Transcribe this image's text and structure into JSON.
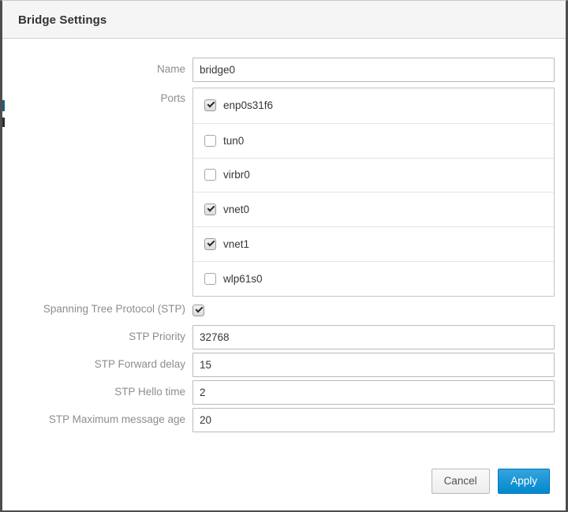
{
  "dialog": {
    "title": "Bridge Settings"
  },
  "form": {
    "name": {
      "label": "Name",
      "value": "bridge0",
      "placeholder": ""
    },
    "ports": {
      "label": "Ports",
      "items": [
        {
          "name": "enp0s31f6",
          "checked": true
        },
        {
          "name": "tun0",
          "checked": false
        },
        {
          "name": "virbr0",
          "checked": false
        },
        {
          "name": "vnet0",
          "checked": true
        },
        {
          "name": "vnet1",
          "checked": true
        },
        {
          "name": "wlp61s0",
          "checked": false
        }
      ]
    },
    "stp": {
      "label": "Spanning Tree Protocol (STP)",
      "checked": true
    },
    "stp_priority": {
      "label": "STP Priority",
      "value": "32768",
      "placeholder": ""
    },
    "stp_forward_delay": {
      "label": "STP Forward delay",
      "value": "15",
      "placeholder": ""
    },
    "stp_hello_time": {
      "label": "STP Hello time",
      "value": "2",
      "placeholder": ""
    },
    "stp_max_message_age": {
      "label": "STP Maximum message age",
      "value": "20",
      "placeholder": ""
    }
  },
  "footer": {
    "cancel_label": "Cancel",
    "apply_label": "Apply"
  },
  "colors": {
    "primary": "#0088ce",
    "primary_border": "#0076bc",
    "titlebar_bg": "#f5f5f5",
    "label_text": "#8b8d8f",
    "body_text": "#363636",
    "field_border": "#bbbbbb",
    "window_border": "#4d4d4d"
  }
}
